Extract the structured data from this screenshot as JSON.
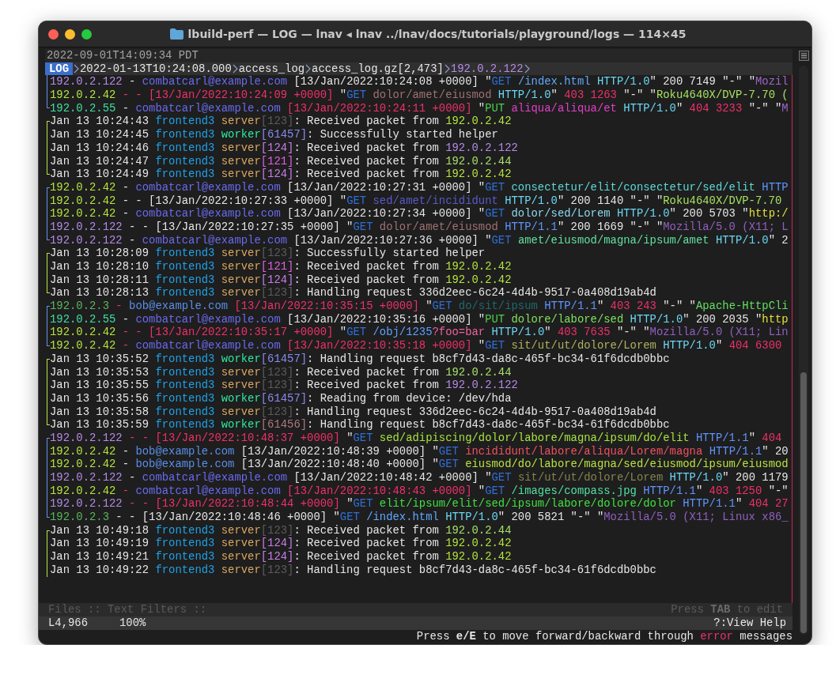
{
  "window": {
    "title": "lbuild-perf — LOG — lnav ◂ lnav ../lnav/docs/tutorials/playground/logs — 114×45"
  },
  "header": {
    "time": "2022-09-01T14:09:34 PDT"
  },
  "breadcrumb": {
    "badge": "LOG",
    "items": [
      {
        "text": "2022-01-13T10:24:08.000",
        "color": "#e6e6e6"
      },
      {
        "text": "access_log",
        "color": "#e6e6e6"
      },
      {
        "text": "access_log.gz[2,473]",
        "color": "#e6e6e6"
      },
      {
        "text": "192.0.2.122",
        "color": "#b48be6"
      }
    ]
  },
  "log_groups": [
    {
      "color": "#6a8ee8",
      "closed_top": false,
      "closed_bottom": true,
      "lines": [
        [
          {
            "text": "192.0.2.122",
            "color": "#b48be6"
          },
          {
            "text": " - "
          },
          {
            "text": "combatcarl@example.com",
            "color": "#6a6af0"
          },
          {
            "text": " [13/Jan/2022:10:24:08 +0000] \""
          },
          {
            "text": "GET ",
            "color": "#2f6fd6"
          },
          {
            "text": "/index.html ",
            "color": "#60a8ff"
          },
          {
            "text": "HTTP/1.0",
            "color": "#6ad8f5"
          },
          {
            "text": "\" 200 7149 \"-\" \""
          },
          {
            "text": "Mozil",
            "color": "#a066c8"
          }
        ],
        [
          {
            "text": "192.0.2.42",
            "color": "#b6e63e"
          },
          {
            "text": " - - [13/Jan/2022:10:24:09 +0000]",
            "color": "#f0306a"
          },
          {
            "text": " \""
          },
          {
            "text": "GET ",
            "color": "#2f6fd6"
          },
          {
            "text": "dolor/amet/eiusmod ",
            "color": "#a07272"
          },
          {
            "text": "HTTP/1.0",
            "color": "#6ad8f5"
          },
          {
            "text": "\" "
          },
          {
            "text": "403 1263",
            "color": "#f0306a"
          },
          {
            "text": " \"-\" \""
          },
          {
            "text": "Roku4640X/DVP-7.70 (",
            "color": "#a6e060"
          }
        ],
        [
          {
            "text": "192.0.2.55",
            "color": "#3de0a0"
          },
          {
            "text": " - "
          },
          {
            "text": "combatcarl@example.com ",
            "color": "#6a6af0"
          },
          {
            "text": "[13/Jan/2022:10:24:11 +0000]",
            "color": "#f0306a"
          },
          {
            "text": " \""
          },
          {
            "text": "PUT ",
            "color": "#4cd04c"
          },
          {
            "text": "aliqua/aliqua/et ",
            "color": "#e040c8"
          },
          {
            "text": "HTTP/1.0",
            "color": "#6ad8f5"
          },
          {
            "text": "\" "
          },
          {
            "text": "404 3233",
            "color": "#f0306a"
          },
          {
            "text": " \"-\" \""
          },
          {
            "text": "M",
            "color": "#a066c8"
          }
        ]
      ]
    },
    {
      "color": "#b6e63e",
      "closed_top": true,
      "closed_bottom": true,
      "lines": [
        [
          {
            "text": "Jan 13 10:24:43 "
          },
          {
            "text": "frontend3 ",
            "color": "#1ea2e8"
          },
          {
            "text": "server",
            "color": "#d9a760"
          },
          {
            "text": "[123]",
            "color": "#5c5c5c"
          },
          {
            "text": ": Received packet from "
          },
          {
            "text": "192.0.2.42",
            "color": "#b6e63e"
          }
        ],
        [
          {
            "text": "Jan 13 10:24:45 "
          },
          {
            "text": "frontend3 ",
            "color": "#1ea2e8"
          },
          {
            "text": "worker",
            "color": "#2ee8a0"
          },
          {
            "text": "[61457]",
            "color": "#8a8af0"
          },
          {
            "text": ": Successfully started helper"
          }
        ],
        [
          {
            "text": "Jan 13 10:24:46 "
          },
          {
            "text": "frontend3 ",
            "color": "#1ea2e8"
          },
          {
            "text": "server",
            "color": "#d9a760"
          },
          {
            "text": "[124]",
            "color": "#c87ee8"
          },
          {
            "text": ": Received packet from "
          },
          {
            "text": "192.0.2.122",
            "color": "#b48be6"
          }
        ],
        [
          {
            "text": "Jan 13 10:24:47 "
          },
          {
            "text": "frontend3 ",
            "color": "#1ea2e8"
          },
          {
            "text": "server",
            "color": "#d9a760"
          },
          {
            "text": "[121]",
            "color": "#e060e0"
          },
          {
            "text": ": Received packet from "
          },
          {
            "text": "192.0.2.44",
            "color": "#a8e06a"
          }
        ],
        [
          {
            "text": "Jan 13 10:24:49 "
          },
          {
            "text": "frontend3 ",
            "color": "#1ea2e8"
          },
          {
            "text": "server",
            "color": "#d9a760"
          },
          {
            "text": "[124]",
            "color": "#c87ee8"
          },
          {
            "text": ": Received packet from "
          },
          {
            "text": "192.0.2.42",
            "color": "#b6e63e"
          }
        ]
      ]
    },
    {
      "color": "#6a8ee8",
      "closed_top": true,
      "closed_bottom": true,
      "lines": [
        [
          {
            "text": "192.0.2.42",
            "color": "#b6e63e"
          },
          {
            "text": " - "
          },
          {
            "text": "combatcarl@example.com",
            "color": "#6a6af0"
          },
          {
            "text": " [13/Jan/2022:10:27:31 +0000] \""
          },
          {
            "text": "GET ",
            "color": "#2f6fd6"
          },
          {
            "text": "consectetur/elit/consectetur/sed/elit ",
            "color": "#5fd7d7"
          },
          {
            "text": "HTTP",
            "color": "#5f95ff"
          }
        ],
        [
          {
            "text": "192.0.2.42",
            "color": "#b6e63e"
          },
          {
            "text": " - - [13/Jan/2022:10:27:33 +0000] \""
          },
          {
            "text": "GET ",
            "color": "#2f6fd6"
          },
          {
            "text": "sed/amet/incididunt ",
            "color": "#5a5ac8"
          },
          {
            "text": "HTTP/1.0",
            "color": "#6ad8f5"
          },
          {
            "text": "\" 200 1140 \"-\" \""
          },
          {
            "text": "Roku4640X/DVP-7.70",
            "color": "#a6e060"
          }
        ],
        [
          {
            "text": "192.0.2.42",
            "color": "#b6e63e"
          },
          {
            "text": " - "
          },
          {
            "text": "combatcarl@example.com",
            "color": "#6a6af0"
          },
          {
            "text": " [13/Jan/2022:10:27:34 +0000] \""
          },
          {
            "text": "GET ",
            "color": "#2f6fd6"
          },
          {
            "text": "dolor/sed/Lorem ",
            "color": "#8cd8f0"
          },
          {
            "text": "HTTP/1.0",
            "color": "#6ad8f5"
          },
          {
            "text": "\" 200 5703 \""
          },
          {
            "text": "http:/",
            "color": "#e0e040"
          }
        ],
        [
          {
            "text": "192.0.2.122",
            "color": "#b48be6"
          },
          {
            "text": " - - [13/Jan/2022:10:27:35 +0000] \""
          },
          {
            "text": "GET ",
            "color": "#2f6fd6"
          },
          {
            "text": "dolor/amet/eiusmod ",
            "color": "#a07272"
          },
          {
            "text": "HTTP/1.1",
            "color": "#5f95ff"
          },
          {
            "text": "\" 200 1669 \"-\" \""
          },
          {
            "text": "Mozilla/5.0 (X11; L",
            "color": "#9060c0"
          }
        ],
        [
          {
            "text": "192.0.2.122",
            "color": "#b48be6"
          },
          {
            "text": " - "
          },
          {
            "text": "combatcarl@example.com",
            "color": "#6a6af0"
          },
          {
            "text": " [13/Jan/2022:10:27:36 +0000] \""
          },
          {
            "text": "GET ",
            "color": "#2f6fd6"
          },
          {
            "text": "amet/eiusmod/magna/ipsum/amet ",
            "color": "#60e0a0"
          },
          {
            "text": "HTTP/1.0",
            "color": "#6ad8f5"
          },
          {
            "text": "\" 2"
          }
        ]
      ]
    },
    {
      "color": "#b6e63e",
      "closed_top": true,
      "closed_bottom": true,
      "lines": [
        [
          {
            "text": "Jan 13 10:28:09 "
          },
          {
            "text": "frontend3 ",
            "color": "#1ea2e8"
          },
          {
            "text": "server",
            "color": "#d9a760"
          },
          {
            "text": "[123]",
            "color": "#5c5c5c"
          },
          {
            "text": ": Successfully started helper"
          }
        ],
        [
          {
            "text": "Jan 13 10:28:10 "
          },
          {
            "text": "frontend3 ",
            "color": "#1ea2e8"
          },
          {
            "text": "server",
            "color": "#d9a760"
          },
          {
            "text": "[121]",
            "color": "#e060e0"
          },
          {
            "text": ": Received packet from "
          },
          {
            "text": "192.0.2.42",
            "color": "#b6e63e"
          }
        ],
        [
          {
            "text": "Jan 13 10:28:11 "
          },
          {
            "text": "frontend3 ",
            "color": "#1ea2e8"
          },
          {
            "text": "server",
            "color": "#d9a760"
          },
          {
            "text": "[124]",
            "color": "#c87ee8"
          },
          {
            "text": ": Received packet from "
          },
          {
            "text": "192.0.2.42",
            "color": "#b6e63e"
          }
        ],
        [
          {
            "text": "Jan 13 10:28:13 "
          },
          {
            "text": "frontend3 ",
            "color": "#1ea2e8"
          },
          {
            "text": "server",
            "color": "#d9a760"
          },
          {
            "text": "[123]",
            "color": "#5c5c5c"
          },
          {
            "text": ": Handling request 336d2eec-6c24-4d4b-9517-0a408d19ab4d"
          }
        ]
      ]
    },
    {
      "color": "#6a8ee8",
      "closed_top": true,
      "closed_bottom": true,
      "lines": [
        [
          {
            "text": "192.0.2.3",
            "color": "#5bb65b"
          },
          {
            "text": " - ",
            "color": "#f0306a"
          },
          {
            "text": "bob@example.com ",
            "color": "#5a8ee8"
          },
          {
            "text": "[13/Jan/2022:10:35:15 +0000]",
            "color": "#f0306a"
          },
          {
            "text": " \""
          },
          {
            "text": "GET ",
            "color": "#2f6fd6"
          },
          {
            "text": "do/sit/ipsum ",
            "color": "#1e6a6a"
          },
          {
            "text": "HTTP/1.1",
            "color": "#5f95ff"
          },
          {
            "text": "\" "
          },
          {
            "text": "403 243",
            "color": "#f0306a"
          },
          {
            "text": " \"-\" \""
          },
          {
            "text": "Apache-HttpCli",
            "color": "#60e060"
          }
        ],
        [
          {
            "text": "192.0.2.55",
            "color": "#3de0a0"
          },
          {
            "text": " - "
          },
          {
            "text": "combatcarl@example.com",
            "color": "#6a6af0"
          },
          {
            "text": " [13/Jan/2022:10:35:16 +0000] \""
          },
          {
            "text": "PUT ",
            "color": "#4cd04c"
          },
          {
            "text": "dolore/labore/sed ",
            "color": "#80e060"
          },
          {
            "text": "HTTP/1.0",
            "color": "#6ad8f5"
          },
          {
            "text": "\" 200 2035 \""
          },
          {
            "text": "http",
            "color": "#e0e040"
          }
        ],
        [
          {
            "text": "192.0.2.42",
            "color": "#b6e63e"
          },
          {
            "text": " - - [13/Jan/2022:10:35:17 +0000]",
            "color": "#f0306a"
          },
          {
            "text": " \""
          },
          {
            "text": "GET ",
            "color": "#2f6fd6"
          },
          {
            "text": "/obj/1235",
            "color": "#5fa0ff"
          },
          {
            "text": "?foo=bar ",
            "color": "#f060a0"
          },
          {
            "text": "HTTP/1.0",
            "color": "#6ad8f5"
          },
          {
            "text": "\" "
          },
          {
            "text": "403 7635",
            "color": "#f0306a"
          },
          {
            "text": " \"-\" \""
          },
          {
            "text": "Mozilla/5.0 (X11; Lin",
            "color": "#9060c0"
          }
        ],
        [
          {
            "text": "192.0.2.42",
            "color": "#b6e63e"
          },
          {
            "text": " - ",
            "color": "#f0306a"
          },
          {
            "text": "combatcarl@example.com ",
            "color": "#6a6af0"
          },
          {
            "text": "[13/Jan/2022:10:35:18 +0000]",
            "color": "#f0306a"
          },
          {
            "text": " \""
          },
          {
            "text": "GET ",
            "color": "#2f6fd6"
          },
          {
            "text": "sit/ut/ut/dolore/Lorem ",
            "color": "#b0b060"
          },
          {
            "text": "HTTP/1.0",
            "color": "#6ad8f5"
          },
          {
            "text": "\" "
          },
          {
            "text": "404 6300",
            "color": "#f0306a"
          }
        ]
      ]
    },
    {
      "color": "#b6e63e",
      "closed_top": true,
      "closed_bottom": true,
      "lines": [
        [
          {
            "text": "Jan 13 10:35:52 "
          },
          {
            "text": "frontend3 ",
            "color": "#1ea2e8"
          },
          {
            "text": "worker",
            "color": "#2ee8a0"
          },
          {
            "text": "[61457]",
            "color": "#8a8af0"
          },
          {
            "text": ": Handling request b8cf7d43-da8c-465f-bc34-61f6dcdb0bbc"
          }
        ],
        [
          {
            "text": "Jan 13 10:35:53 "
          },
          {
            "text": "frontend3 ",
            "color": "#1ea2e8"
          },
          {
            "text": "server",
            "color": "#d9a760"
          },
          {
            "text": "[123]",
            "color": "#5c5c5c"
          },
          {
            "text": ": Received packet from "
          },
          {
            "text": "192.0.2.44",
            "color": "#a8e06a"
          }
        ],
        [
          {
            "text": "Jan 13 10:35:55 "
          },
          {
            "text": "frontend3 ",
            "color": "#1ea2e8"
          },
          {
            "text": "server",
            "color": "#d9a760"
          },
          {
            "text": "[123]",
            "color": "#5c5c5c"
          },
          {
            "text": ": Received packet from "
          },
          {
            "text": "192.0.2.122",
            "color": "#b48be6"
          }
        ],
        [
          {
            "text": "Jan 13 10:35:56 "
          },
          {
            "text": "frontend3 ",
            "color": "#1ea2e8"
          },
          {
            "text": "worker",
            "color": "#2ee8a0"
          },
          {
            "text": "[61457]",
            "color": "#8a8af0"
          },
          {
            "text": ": Reading from device: /dev/hda"
          }
        ],
        [
          {
            "text": "Jan 13 10:35:58 "
          },
          {
            "text": "frontend3 ",
            "color": "#1ea2e8"
          },
          {
            "text": "server",
            "color": "#d9a760"
          },
          {
            "text": "[123]",
            "color": "#5c5c5c"
          },
          {
            "text": ": Handling request 336d2eec-6c24-4d4b-9517-0a408d19ab4d"
          }
        ],
        [
          {
            "text": "Jan 13 10:35:59 "
          },
          {
            "text": "frontend3 ",
            "color": "#1ea2e8"
          },
          {
            "text": "worker",
            "color": "#2ee8a0"
          },
          {
            "text": "[61456]",
            "color": "#b07a80"
          },
          {
            "text": ": Handling request b8cf7d43-da8c-465f-bc34-61f6dcdb0bbc"
          }
        ]
      ]
    },
    {
      "color": "#6a8ee8",
      "closed_top": true,
      "closed_bottom": true,
      "lines": [
        [
          {
            "text": "192.0.2.122",
            "color": "#b48be6"
          },
          {
            "text": " - - [13/Jan/2022:10:48:37 +0000]",
            "color": "#f0306a"
          },
          {
            "text": " \""
          },
          {
            "text": "GET ",
            "color": "#2f6fd6"
          },
          {
            "text": "sed/adipiscing/dolor/labore/magna/ipsum/do/elit ",
            "color": "#a6e040"
          },
          {
            "text": "HTTP/1.1",
            "color": "#5f95ff"
          },
          {
            "text": "\" "
          },
          {
            "text": "404",
            "color": "#f0306a"
          }
        ],
        [
          {
            "text": "192.0.2.42",
            "color": "#b6e63e"
          },
          {
            "text": " - "
          },
          {
            "text": "bob@example.com",
            "color": "#5a8ee8"
          },
          {
            "text": " [13/Jan/2022:10:48:39 +0000] \""
          },
          {
            "text": "GET ",
            "color": "#2f6fd6"
          },
          {
            "text": "incididunt/labore/aliqua/Lorem/magna ",
            "color": "#f05060"
          },
          {
            "text": "HTTP/1.1",
            "color": "#5f95ff"
          },
          {
            "text": "\" 20"
          }
        ],
        [
          {
            "text": "192.0.2.42",
            "color": "#b6e63e"
          },
          {
            "text": " - "
          },
          {
            "text": "bob@example.com",
            "color": "#5a8ee8"
          },
          {
            "text": " [13/Jan/2022:10:48:40 +0000] \""
          },
          {
            "text": "GET ",
            "color": "#2f6fd6"
          },
          {
            "text": "eiusmod/do/labore/magna/sed/eiusmod/ipsum/eiusmod",
            "color": "#b8e040"
          }
        ],
        [
          {
            "text": "192.0.2.122",
            "color": "#b48be6"
          },
          {
            "text": " - "
          },
          {
            "text": "combatcarl@example.com",
            "color": "#6a6af0"
          },
          {
            "text": " [13/Jan/2022:10:48:42 +0000] \""
          },
          {
            "text": "GET ",
            "color": "#2f6fd6"
          },
          {
            "text": "sit/ut/ut/dolore/Lorem ",
            "color": "#848450"
          },
          {
            "text": "HTTP/1.0",
            "color": "#6ad8f5"
          },
          {
            "text": "\" 200 1179"
          }
        ],
        [
          {
            "text": "192.0.2.42",
            "color": "#b6e63e"
          },
          {
            "text": " - ",
            "color": "#f0306a"
          },
          {
            "text": "combatcarl@example.com ",
            "color": "#6a6af0"
          },
          {
            "text": "[13/Jan/2022:10:48:43 +0000]",
            "color": "#f0306a"
          },
          {
            "text": " \""
          },
          {
            "text": "GET ",
            "color": "#2f6fd6"
          },
          {
            "text": "/images/compass.jpg ",
            "color": "#50e0a0"
          },
          {
            "text": "HTTP/1.1",
            "color": "#5f95ff"
          },
          {
            "text": "\" "
          },
          {
            "text": "403 1250",
            "color": "#f0306a"
          },
          {
            "text": " \"-\""
          }
        ],
        [
          {
            "text": "192.0.2.122",
            "color": "#b48be6"
          },
          {
            "text": " - - [13/Jan/2022:10:48:44 +0000]",
            "color": "#f0306a"
          },
          {
            "text": " \""
          },
          {
            "text": "GET ",
            "color": "#2f6fd6"
          },
          {
            "text": "elit/ipsum/elit/sed/ipsum/labore/dolore/dolor ",
            "color": "#40e040"
          },
          {
            "text": "HTTP/1.1",
            "color": "#5f95ff"
          },
          {
            "text": "\" "
          },
          {
            "text": "404 27",
            "color": "#f0306a"
          }
        ],
        [
          {
            "text": "192.0.2.3",
            "color": "#5bb65b"
          },
          {
            "text": " - - [13/Jan/2022:10:48:46 +0000] \""
          },
          {
            "text": "GET ",
            "color": "#2f6fd6"
          },
          {
            "text": "/index.html ",
            "color": "#60a8ff"
          },
          {
            "text": "HTTP/1.0",
            "color": "#6ad8f5"
          },
          {
            "text": "\" 200 5821 \"-\" \""
          },
          {
            "text": "Mozilla/5.0 (X11; Linux x86_",
            "color": "#9060c0"
          }
        ]
      ]
    },
    {
      "color": "#b6e63e",
      "closed_top": true,
      "closed_bottom": false,
      "lines": [
        [
          {
            "text": "Jan 13 10:49:18 "
          },
          {
            "text": "frontend3 ",
            "color": "#1ea2e8"
          },
          {
            "text": "server",
            "color": "#d9a760"
          },
          {
            "text": "[123]",
            "color": "#5c5c5c"
          },
          {
            "text": ": Received packet from "
          },
          {
            "text": "192.0.2.44",
            "color": "#a8e06a"
          }
        ],
        [
          {
            "text": "Jan 13 10:49:19 "
          },
          {
            "text": "frontend3 ",
            "color": "#1ea2e8"
          },
          {
            "text": "server",
            "color": "#d9a760"
          },
          {
            "text": "[124]",
            "color": "#c87ee8"
          },
          {
            "text": ": Received packet from "
          },
          {
            "text": "192.0.2.42",
            "color": "#b6e63e"
          }
        ],
        [
          {
            "text": "Jan 13 10:49:21 "
          },
          {
            "text": "frontend3 ",
            "color": "#1ea2e8"
          },
          {
            "text": "server",
            "color": "#d9a760"
          },
          {
            "text": "[124]",
            "color": "#c87ee8"
          },
          {
            "text": ": Received packet from "
          },
          {
            "text": "192.0.2.42",
            "color": "#b6e63e"
          }
        ],
        [
          {
            "text": "Jan 13 10:49:22 "
          },
          {
            "text": "frontend3 ",
            "color": "#1ea2e8"
          },
          {
            "text": "server",
            "color": "#d9a760"
          },
          {
            "text": "[123]",
            "color": "#5c5c5c"
          },
          {
            "text": ": Handling request b8cf7d43-da8c-465f-bc34-61f6dcdb0bbc"
          }
        ]
      ]
    }
  ],
  "filter_bar": {
    "label": "Files :: Text Filters ::",
    "hint": "Press **TAB** to edit"
  },
  "status_bar": {
    "line": "L4,966",
    "percent": "100%",
    "help": "?:View Help"
  },
  "message": [
    {
      "text": "Press **e/E** to move forward/backward through "
    },
    {
      "text": "error",
      "color": "#f0306a"
    },
    {
      "text": " messages"
    }
  ]
}
